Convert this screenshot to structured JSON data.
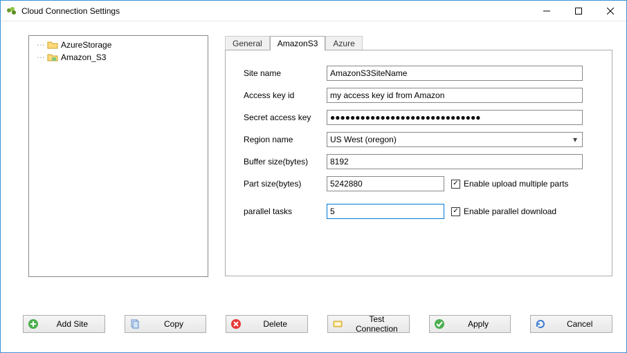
{
  "window": {
    "title": "Cloud Connection Settings"
  },
  "tree": {
    "items": [
      {
        "label": "AzureStorage"
      },
      {
        "label": "Amazon_S3"
      }
    ]
  },
  "tabs": {
    "general": "General",
    "amazons3": "AmazonS3",
    "azure": "Azure",
    "active": "amazons3"
  },
  "form": {
    "site_name": {
      "label": "Site name",
      "value": "AmazonS3SiteName"
    },
    "access_key": {
      "label": "Access key id",
      "value": "my access key id from Amazon"
    },
    "secret_key": {
      "label": "Secret access key",
      "value": "●●●●●●●●●●●●●●●●●●●●●●●●●●●●●●"
    },
    "region": {
      "label": "Region name",
      "value": "US West (oregon)"
    },
    "buffer": {
      "label": "Buffer size(bytes)",
      "value": "8192"
    },
    "part": {
      "label": "Part size(bytes)",
      "value": "5242880",
      "checkbox": "Enable upload multiple parts",
      "checked": true
    },
    "parallel": {
      "label": "parallel tasks",
      "value": "5",
      "checkbox": "Enable parallel download",
      "checked": true
    }
  },
  "buttons": {
    "add": "Add Site",
    "copy": "Copy",
    "delete": "Delete",
    "test": "Test Connection",
    "apply": "Apply",
    "cancel": "Cancel"
  }
}
